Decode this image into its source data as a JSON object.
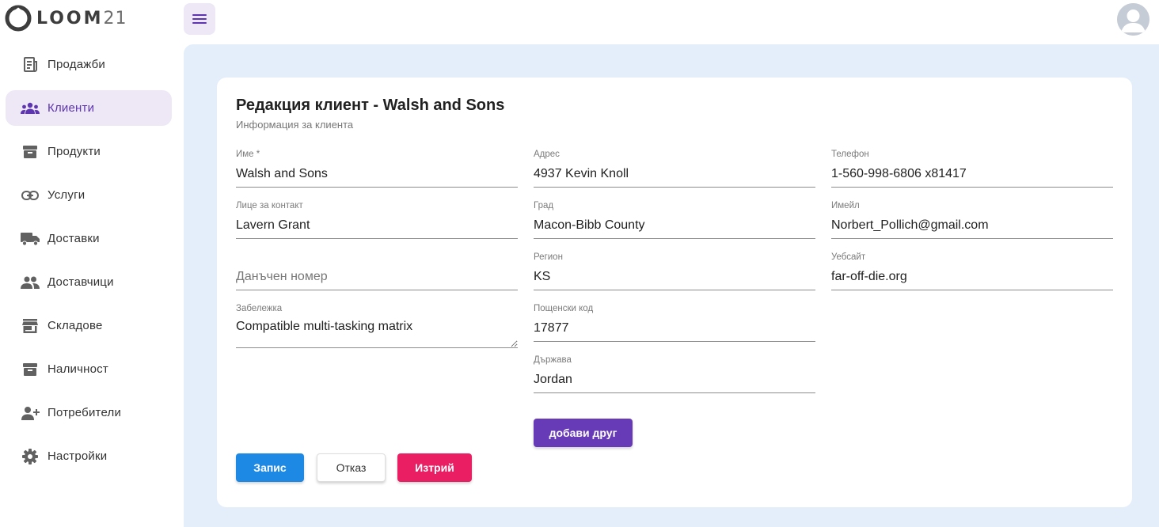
{
  "brand": {
    "name": "LOOM",
    "number": "21"
  },
  "sidebar": {
    "items": [
      {
        "label": "Продажби",
        "icon": "receipt-icon",
        "active": false
      },
      {
        "label": "Клиенти",
        "icon": "groups-icon",
        "active": true
      },
      {
        "label": "Продукти",
        "icon": "archive-box-icon",
        "active": false
      },
      {
        "label": "Услуги",
        "icon": "link-icon",
        "active": false
      },
      {
        "label": "Доставки",
        "icon": "truck-icon",
        "active": false
      },
      {
        "label": "Доставчици",
        "icon": "people-icon",
        "active": false
      },
      {
        "label": "Складове",
        "icon": "store-icon",
        "active": false
      },
      {
        "label": "Наличност",
        "icon": "inventory-box-icon",
        "active": false
      },
      {
        "label": "Потребители",
        "icon": "person-add-icon",
        "active": false
      },
      {
        "label": "Настройки",
        "icon": "gear-icon",
        "active": false
      }
    ]
  },
  "header": {
    "menu_icon": "hamburger-menu-icon",
    "avatar_icon": "user-avatar-icon"
  },
  "form": {
    "title": "Редакция клиент - Walsh and Sons",
    "subtitle": "Информация за клиента",
    "fields": {
      "name": {
        "label": "Име *",
        "value": "Walsh and Sons"
      },
      "contact": {
        "label": "Лице за контакт",
        "value": "Lavern Grant"
      },
      "tax": {
        "label": "",
        "value": "",
        "placeholder": "Данъчен номер"
      },
      "note": {
        "label": "Забележка",
        "value": "Compatible multi-tasking matrix"
      },
      "address": {
        "label": "Адрес",
        "value": "4937 Kevin Knoll"
      },
      "city": {
        "label": "Град",
        "value": "Macon-Bibb County"
      },
      "region": {
        "label": "Регион",
        "value": "KS"
      },
      "postal": {
        "label": "Пощенски код",
        "value": "17877"
      },
      "country": {
        "label": "Държава",
        "value": "Jordan"
      },
      "phone": {
        "label": "Телефон",
        "value": "1-560-998-6806 x81417"
      },
      "email": {
        "label": "Имейл",
        "value": "Norbert_Pollich@gmail.com"
      },
      "website": {
        "label": "Уебсайт",
        "value": "far-off-die.org"
      }
    },
    "buttons": {
      "add_other": "добави друг",
      "save": "Запис",
      "cancel": "Отказ",
      "delete": "Изтрий"
    }
  },
  "colors": {
    "accent_purple": "#673ab7",
    "active_bg": "#ede7f6",
    "main_bg": "#e3eefa",
    "save_blue": "#1e88e5",
    "delete_pink": "#e91e63"
  }
}
